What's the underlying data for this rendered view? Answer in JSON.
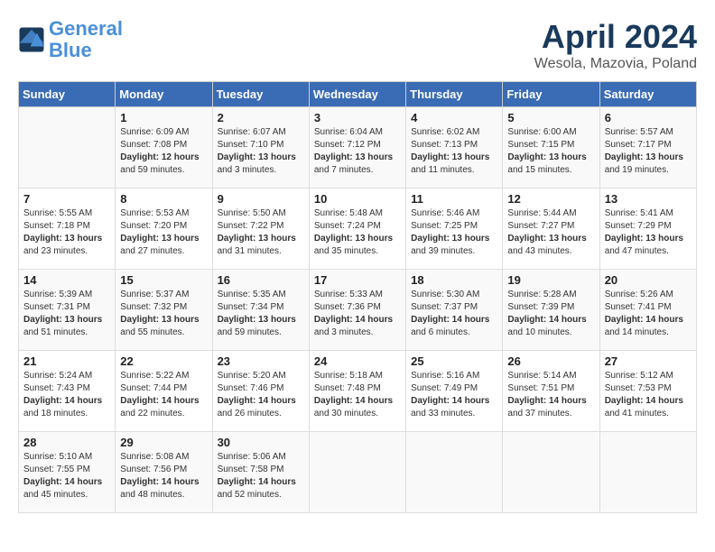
{
  "header": {
    "logo_line1": "General",
    "logo_line2": "Blue",
    "month": "April 2024",
    "location": "Wesola, Mazovia, Poland"
  },
  "days_of_week": [
    "Sunday",
    "Monday",
    "Tuesday",
    "Wednesday",
    "Thursday",
    "Friday",
    "Saturday"
  ],
  "weeks": [
    [
      {
        "day": "",
        "info": ""
      },
      {
        "day": "1",
        "info": "Sunrise: 6:09 AM\nSunset: 7:08 PM\nDaylight: 12 hours\nand 59 minutes."
      },
      {
        "day": "2",
        "info": "Sunrise: 6:07 AM\nSunset: 7:10 PM\nDaylight: 13 hours\nand 3 minutes."
      },
      {
        "day": "3",
        "info": "Sunrise: 6:04 AM\nSunset: 7:12 PM\nDaylight: 13 hours\nand 7 minutes."
      },
      {
        "day": "4",
        "info": "Sunrise: 6:02 AM\nSunset: 7:13 PM\nDaylight: 13 hours\nand 11 minutes."
      },
      {
        "day": "5",
        "info": "Sunrise: 6:00 AM\nSunset: 7:15 PM\nDaylight: 13 hours\nand 15 minutes."
      },
      {
        "day": "6",
        "info": "Sunrise: 5:57 AM\nSunset: 7:17 PM\nDaylight: 13 hours\nand 19 minutes."
      }
    ],
    [
      {
        "day": "7",
        "info": "Sunrise: 5:55 AM\nSunset: 7:18 PM\nDaylight: 13 hours\nand 23 minutes."
      },
      {
        "day": "8",
        "info": "Sunrise: 5:53 AM\nSunset: 7:20 PM\nDaylight: 13 hours\nand 27 minutes."
      },
      {
        "day": "9",
        "info": "Sunrise: 5:50 AM\nSunset: 7:22 PM\nDaylight: 13 hours\nand 31 minutes."
      },
      {
        "day": "10",
        "info": "Sunrise: 5:48 AM\nSunset: 7:24 PM\nDaylight: 13 hours\nand 35 minutes."
      },
      {
        "day": "11",
        "info": "Sunrise: 5:46 AM\nSunset: 7:25 PM\nDaylight: 13 hours\nand 39 minutes."
      },
      {
        "day": "12",
        "info": "Sunrise: 5:44 AM\nSunset: 7:27 PM\nDaylight: 13 hours\nand 43 minutes."
      },
      {
        "day": "13",
        "info": "Sunrise: 5:41 AM\nSunset: 7:29 PM\nDaylight: 13 hours\nand 47 minutes."
      }
    ],
    [
      {
        "day": "14",
        "info": "Sunrise: 5:39 AM\nSunset: 7:31 PM\nDaylight: 13 hours\nand 51 minutes."
      },
      {
        "day": "15",
        "info": "Sunrise: 5:37 AM\nSunset: 7:32 PM\nDaylight: 13 hours\nand 55 minutes."
      },
      {
        "day": "16",
        "info": "Sunrise: 5:35 AM\nSunset: 7:34 PM\nDaylight: 13 hours\nand 59 minutes."
      },
      {
        "day": "17",
        "info": "Sunrise: 5:33 AM\nSunset: 7:36 PM\nDaylight: 14 hours\nand 3 minutes."
      },
      {
        "day": "18",
        "info": "Sunrise: 5:30 AM\nSunset: 7:37 PM\nDaylight: 14 hours\nand 6 minutes."
      },
      {
        "day": "19",
        "info": "Sunrise: 5:28 AM\nSunset: 7:39 PM\nDaylight: 14 hours\nand 10 minutes."
      },
      {
        "day": "20",
        "info": "Sunrise: 5:26 AM\nSunset: 7:41 PM\nDaylight: 14 hours\nand 14 minutes."
      }
    ],
    [
      {
        "day": "21",
        "info": "Sunrise: 5:24 AM\nSunset: 7:43 PM\nDaylight: 14 hours\nand 18 minutes."
      },
      {
        "day": "22",
        "info": "Sunrise: 5:22 AM\nSunset: 7:44 PM\nDaylight: 14 hours\nand 22 minutes."
      },
      {
        "day": "23",
        "info": "Sunrise: 5:20 AM\nSunset: 7:46 PM\nDaylight: 14 hours\nand 26 minutes."
      },
      {
        "day": "24",
        "info": "Sunrise: 5:18 AM\nSunset: 7:48 PM\nDaylight: 14 hours\nand 30 minutes."
      },
      {
        "day": "25",
        "info": "Sunrise: 5:16 AM\nSunset: 7:49 PM\nDaylight: 14 hours\nand 33 minutes."
      },
      {
        "day": "26",
        "info": "Sunrise: 5:14 AM\nSunset: 7:51 PM\nDaylight: 14 hours\nand 37 minutes."
      },
      {
        "day": "27",
        "info": "Sunrise: 5:12 AM\nSunset: 7:53 PM\nDaylight: 14 hours\nand 41 minutes."
      }
    ],
    [
      {
        "day": "28",
        "info": "Sunrise: 5:10 AM\nSunset: 7:55 PM\nDaylight: 14 hours\nand 45 minutes."
      },
      {
        "day": "29",
        "info": "Sunrise: 5:08 AM\nSunset: 7:56 PM\nDaylight: 14 hours\nand 48 minutes."
      },
      {
        "day": "30",
        "info": "Sunrise: 5:06 AM\nSunset: 7:58 PM\nDaylight: 14 hours\nand 52 minutes."
      },
      {
        "day": "",
        "info": ""
      },
      {
        "day": "",
        "info": ""
      },
      {
        "day": "",
        "info": ""
      },
      {
        "day": "",
        "info": ""
      }
    ]
  ]
}
